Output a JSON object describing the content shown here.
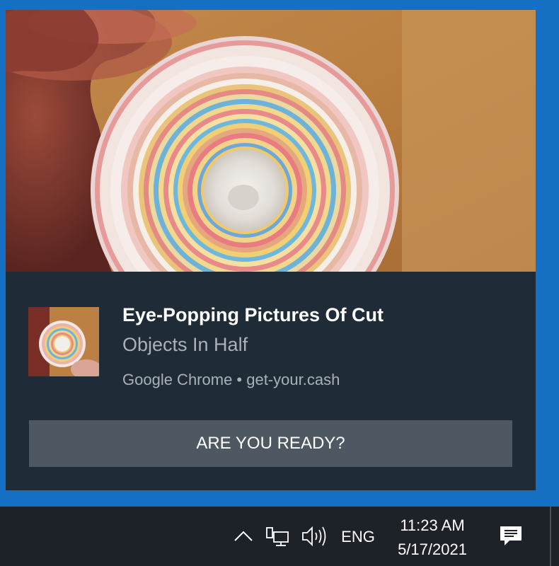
{
  "notification": {
    "title": "Eye-Popping Pictures Of Cut",
    "subtitle": "Objects In Half",
    "attribution": "Google Chrome • get-your.cash",
    "action_label": "ARE YOU READY?",
    "hero_image": "cut-candy-cross-section",
    "thumbnail_image": "cut-candy-cross-section-thumb"
  },
  "taskbar": {
    "tray_icons": [
      "chevron-up-icon",
      "network-icon",
      "speaker-icon",
      "action-center-icon"
    ],
    "language": "ENG",
    "time": "11:23 AM",
    "date": "5/17/2021"
  },
  "colors": {
    "accent_blue": "#1570c4",
    "toast_bg": "#1f2b36",
    "button_bg": "#4e5862",
    "taskbar_bg": "#1c2228"
  }
}
